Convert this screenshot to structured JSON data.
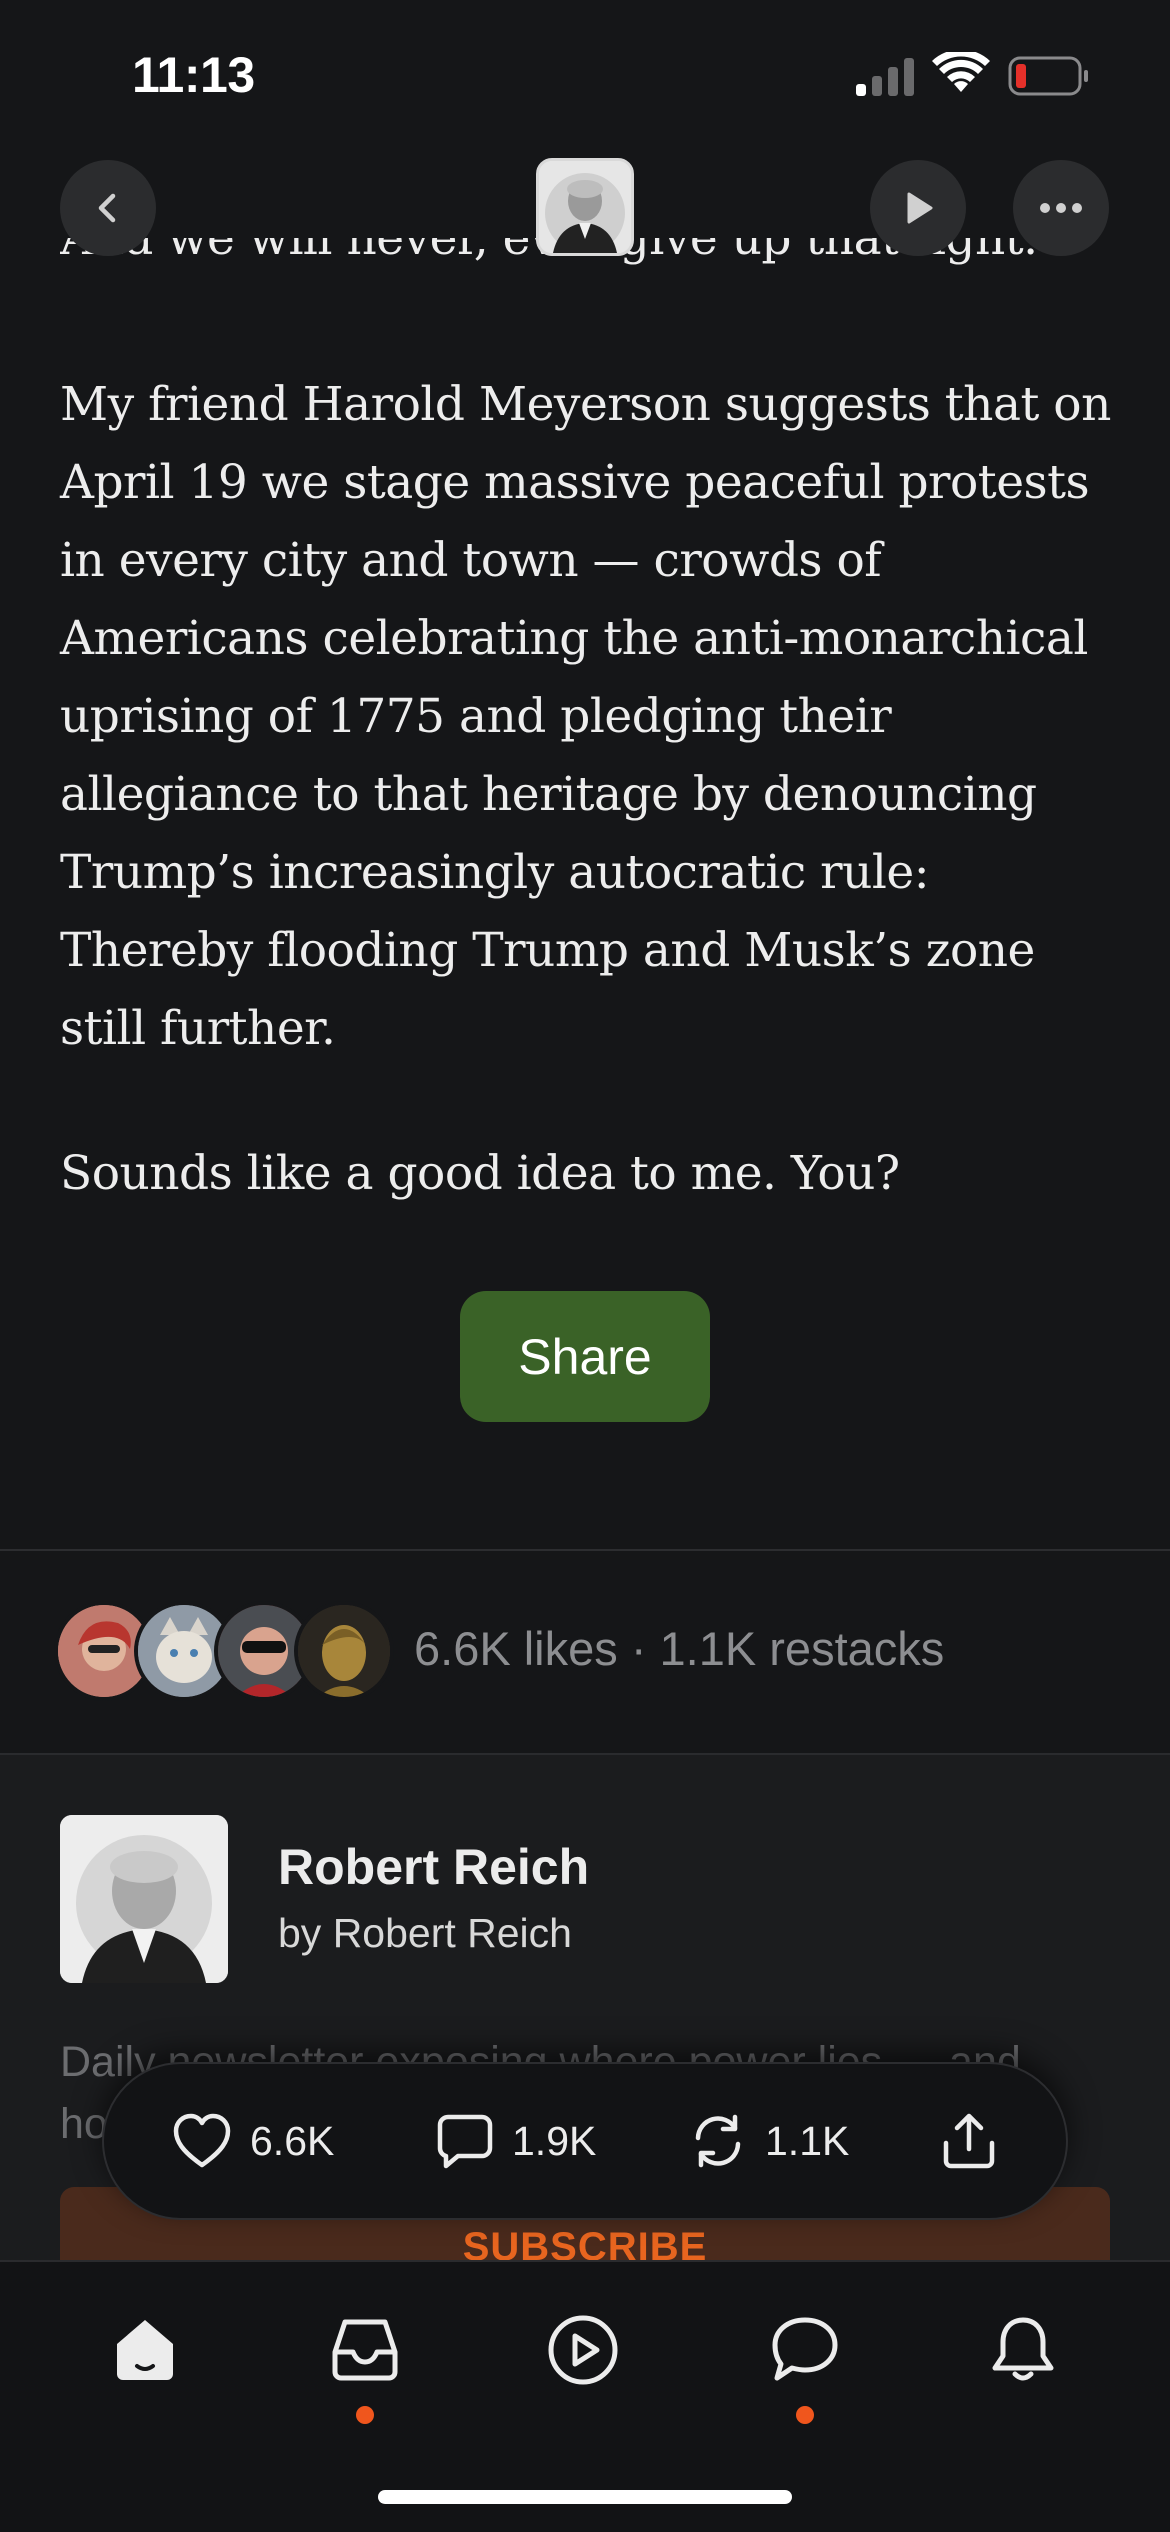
{
  "status": {
    "time": "11:13"
  },
  "article": {
    "cut_line": "And we will never, ever give up that fight.",
    "paragraph": "My friend Harold Meyerson suggests that on April 19 we stage massive peaceful protests in every city and town — crowds of Americans celebrating the anti-monarchical uprising of 1775 and pledging their allegiance to that heritage by denouncing Trump’s increasingly autocratic rule: Thereby flooding Trump and Musk’s zone still further.",
    "closing": "Sounds like a good idea to me. You?",
    "share_label": "Share"
  },
  "engagement": {
    "summary": "6.6K likes · 1.1K restacks"
  },
  "publication": {
    "name": "Robert Reich",
    "byline": "by Robert Reich",
    "description": "Daily newsletter exposing where power lies — and how",
    "subscribe_label": "SUBSCRIBE"
  },
  "actions": {
    "likes": "6.6K",
    "comments": "1.9K",
    "restacks": "1.1K"
  },
  "colors": {
    "background": "#151618",
    "share_button": "#3a6227",
    "subscribe_text": "#e8651f",
    "notification_dot": "#f0561d",
    "battery_low": "#e5302a"
  },
  "icons": {
    "top_nav": [
      "back-chevron-icon",
      "author-avatar",
      "play-icon",
      "more-icon"
    ],
    "actions": [
      "heart-icon",
      "comment-icon",
      "restack-icon",
      "share-upload-icon"
    ],
    "tabs": [
      "home-icon",
      "inbox-icon",
      "play-circle-icon",
      "chat-icon",
      "bell-icon"
    ]
  }
}
